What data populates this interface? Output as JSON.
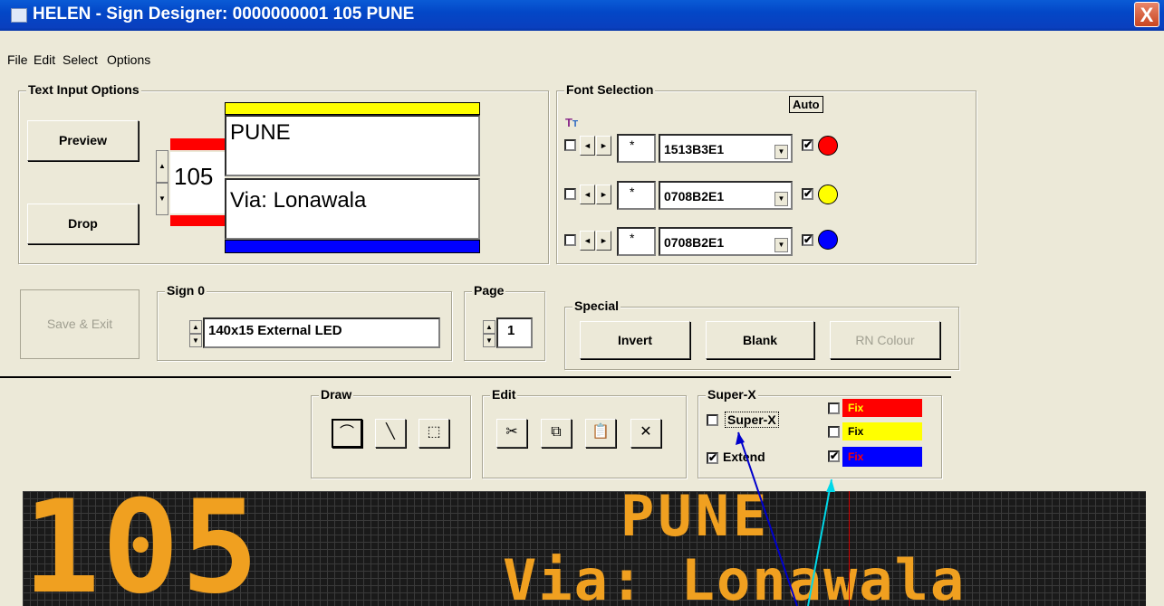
{
  "window": {
    "title": "HELEN - Sign Designer: 0000000001 105 PUNE",
    "close": "X"
  },
  "menu": [
    {
      "label": "File"
    },
    {
      "label": "Edit"
    },
    {
      "label": "Select"
    },
    {
      "label": "Options"
    }
  ],
  "text_input": {
    "group_label": "Text Input Options",
    "preview_label": "Preview",
    "drop_label": "Drop",
    "route_number": "105",
    "line1": "PUNE",
    "line2": "Via: Lonawala"
  },
  "font_selection": {
    "group_label": "Font Selection",
    "auto_label": "Auto",
    "rows": [
      {
        "star": "*",
        "font": "1513B3E1",
        "checked": "✔",
        "color": "#ff0000"
      },
      {
        "star": "*",
        "font": "0708B2E1",
        "checked": "✔",
        "color": "#ffff00"
      },
      {
        "star": "*",
        "font": "0708B2E1",
        "checked": "✔",
        "color": "#0000ff"
      }
    ]
  },
  "save_exit_label": "Save & Exit",
  "sign": {
    "group_label": "Sign 0",
    "value": "140x15 External LED"
  },
  "page": {
    "group_label": "Page",
    "value": "1"
  },
  "special": {
    "group_label": "Special",
    "invert_label": "Invert",
    "blank_label": "Blank",
    "rn_colour_label": "RN Colour"
  },
  "draw": {
    "group_label": "Draw"
  },
  "edit": {
    "group_label": "Edit"
  },
  "superx": {
    "group_label": "Super-X",
    "superx_label": "Super-X",
    "superx_checked": "",
    "extend_label": "Extend",
    "extend_checked": "✔",
    "fix": [
      {
        "label": "Fix",
        "checked": "",
        "bg": "#ff0000",
        "fg": "#ffff00"
      },
      {
        "label": "Fix",
        "checked": "",
        "bg": "#ffff00",
        "fg": "#000000"
      },
      {
        "label": "Fix",
        "checked": "✔",
        "bg": "#0000ff",
        "fg": "#ff0000"
      }
    ]
  },
  "led": {
    "route": "105",
    "line1": "PUNE",
    "line2": "Via: Lonawala",
    "color": "#f0a020"
  }
}
